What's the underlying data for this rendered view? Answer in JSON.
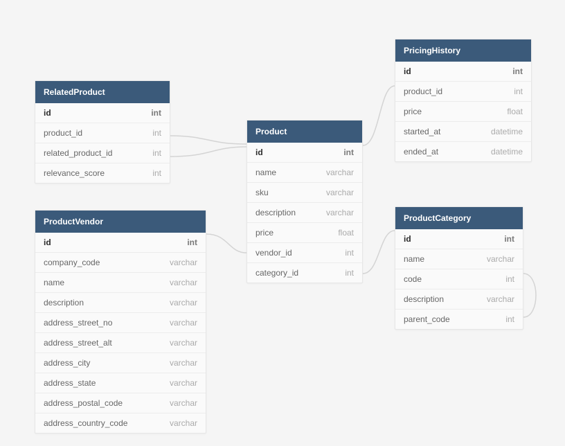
{
  "tables": {
    "relatedproduct": {
      "title": "RelatedProduct",
      "rows": [
        {
          "name": "id",
          "type": "int",
          "pk": true
        },
        {
          "name": "product_id",
          "type": "int"
        },
        {
          "name": "related_product_id",
          "type": "int"
        },
        {
          "name": "relevance_score",
          "type": "int"
        }
      ]
    },
    "productvendor": {
      "title": "ProductVendor",
      "rows": [
        {
          "name": "id",
          "type": "int",
          "pk": true
        },
        {
          "name": "company_code",
          "type": "varchar"
        },
        {
          "name": "name",
          "type": "varchar"
        },
        {
          "name": "description",
          "type": "varchar"
        },
        {
          "name": "address_street_no",
          "type": "varchar"
        },
        {
          "name": "address_street_alt",
          "type": "varchar"
        },
        {
          "name": "address_city",
          "type": "varchar"
        },
        {
          "name": "address_state",
          "type": "varchar"
        },
        {
          "name": "address_postal_code",
          "type": "varchar"
        },
        {
          "name": "address_country_code",
          "type": "varchar"
        }
      ]
    },
    "product": {
      "title": "Product",
      "rows": [
        {
          "name": "id",
          "type": "int",
          "pk": true
        },
        {
          "name": "name",
          "type": "varchar"
        },
        {
          "name": "sku",
          "type": "varchar"
        },
        {
          "name": "description",
          "type": "varchar"
        },
        {
          "name": "price",
          "type": "float"
        },
        {
          "name": "vendor_id",
          "type": "int"
        },
        {
          "name": "category_id",
          "type": "int"
        }
      ]
    },
    "pricinghistory": {
      "title": "PricingHistory",
      "rows": [
        {
          "name": "id",
          "type": "int",
          "pk": true
        },
        {
          "name": "product_id",
          "type": "int"
        },
        {
          "name": "price",
          "type": "float"
        },
        {
          "name": "started_at",
          "type": "datetime"
        },
        {
          "name": "ended_at",
          "type": "datetime"
        }
      ]
    },
    "productcategory": {
      "title": "ProductCategory",
      "rows": [
        {
          "name": "id",
          "type": "int",
          "pk": true
        },
        {
          "name": "name",
          "type": "varchar"
        },
        {
          "name": "code",
          "type": "int"
        },
        {
          "name": "description",
          "type": "varchar"
        },
        {
          "name": "parent_code",
          "type": "int"
        }
      ]
    }
  },
  "connectors": {
    "stroke": "#d4d4d4"
  }
}
